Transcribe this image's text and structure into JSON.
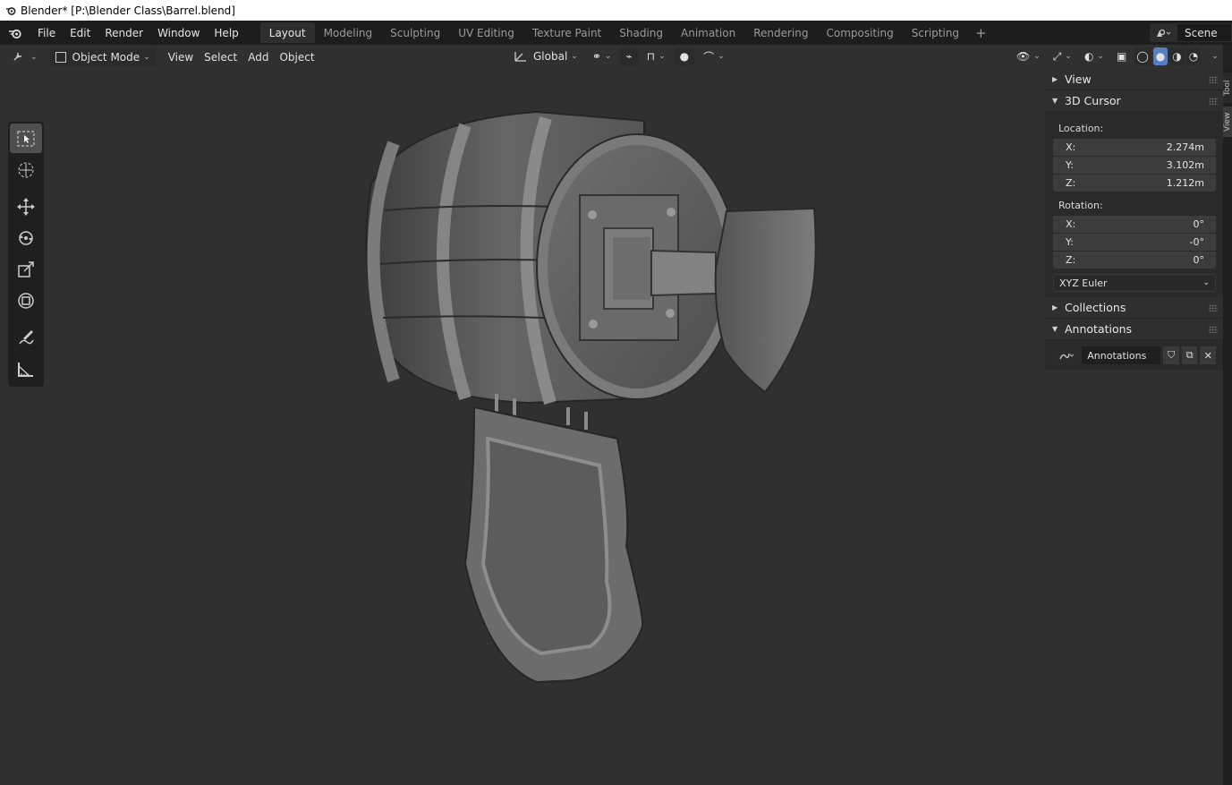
{
  "window": {
    "title": "Blender* [P:\\Blender Class\\Barrel.blend]"
  },
  "menu": [
    "File",
    "Edit",
    "Render",
    "Window",
    "Help"
  ],
  "workspaces": [
    {
      "label": "Layout",
      "active": true
    },
    {
      "label": "Modeling"
    },
    {
      "label": "Sculpting"
    },
    {
      "label": "UV Editing"
    },
    {
      "label": "Texture Paint"
    },
    {
      "label": "Shading"
    },
    {
      "label": "Animation"
    },
    {
      "label": "Rendering"
    },
    {
      "label": "Compositing"
    },
    {
      "label": "Scripting"
    }
  ],
  "scene": {
    "name": "Scene"
  },
  "header": {
    "mode": "Object Mode",
    "view": "View",
    "select": "Select",
    "add": "Add",
    "object": "Object",
    "orientation": "Global"
  },
  "sidebar": {
    "view_panel": "View",
    "cursor_panel": "3D Cursor",
    "location_label": "Location:",
    "location": [
      {
        "axis": "X:",
        "value": "2.274m"
      },
      {
        "axis": "Y:",
        "value": "3.102m"
      },
      {
        "axis": "Z:",
        "value": "1.212m"
      }
    ],
    "rotation_label": "Rotation:",
    "rotation": [
      {
        "axis": "X:",
        "value": "0°"
      },
      {
        "axis": "Y:",
        "value": "-0°"
      },
      {
        "axis": "Z:",
        "value": "0°"
      }
    ],
    "rotation_mode": "XYZ Euler",
    "collections_panel": "Collections",
    "annotations_panel": "Annotations",
    "annotation_name": "Annotations",
    "tabs": [
      "Tool",
      "View"
    ]
  },
  "colors": {
    "accent": "#4772b3",
    "background": "#303030"
  }
}
